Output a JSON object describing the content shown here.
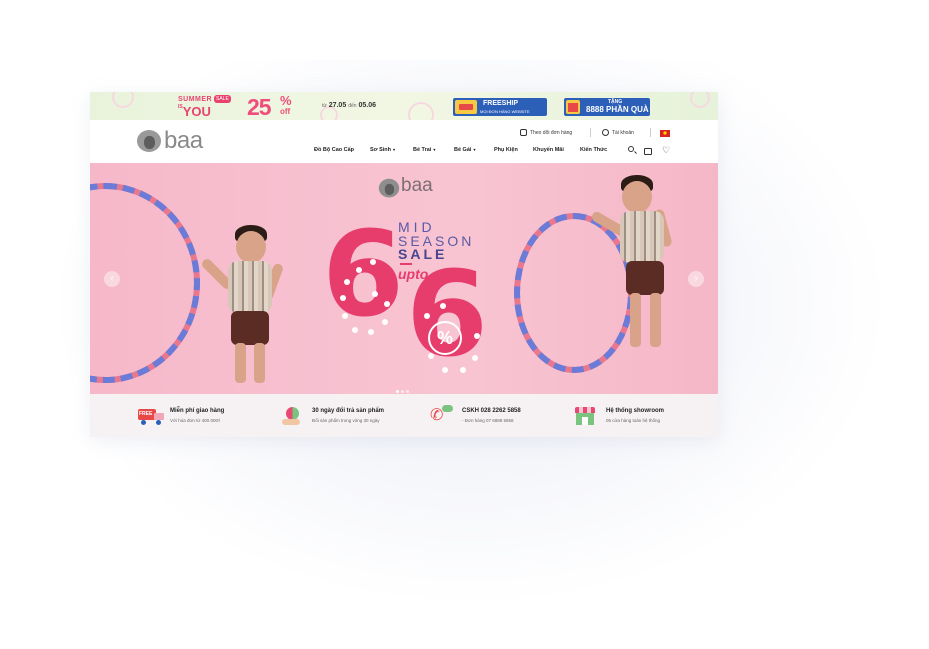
{
  "promo": {
    "summer_line1": "SUMMER",
    "summer_line2": "YOU",
    "summer_is": "IS",
    "summer_tag": "SALE",
    "discount_number": "25",
    "discount_pct": "%",
    "discount_off": "off",
    "date_from_label": "từ",
    "date_from": "27.05",
    "date_to_label": "đến",
    "date_to": "05.06",
    "freeship_title": "FREESHIP",
    "freeship_sub": "MỌI ĐƠN HÀNG WEBSITE",
    "gift_title": "TẶNG",
    "gift_sub": "8888 PHẦN QUÀ"
  },
  "header": {
    "logo_text": "baa",
    "order_tracking": "Theo dõi đơn hàng",
    "account": "Tài khoản",
    "nav": [
      {
        "label": "Đồ Bộ Cao Cấp",
        "caret": false
      },
      {
        "label": "Sơ Sinh",
        "caret": true
      },
      {
        "label": "Bé Trai",
        "caret": true
      },
      {
        "label": "Bé Gái",
        "caret": true
      },
      {
        "label": "Phụ Kiện",
        "caret": false
      },
      {
        "label": "Khuyến Mãi",
        "caret": false
      },
      {
        "label": "Kiến Thức",
        "caret": false
      }
    ],
    "caret_glyph": "▾"
  },
  "hero": {
    "logo_text": "baa",
    "line_mid": "MID",
    "line_season": "SEASON",
    "line_sale": "SALE",
    "upto": "upto",
    "digit_left": "6",
    "digit_right": "6",
    "percent": "%",
    "prev_glyph": "‹",
    "next_glyph": "›",
    "slide_count": 3,
    "active_slide": 1
  },
  "features": [
    {
      "icon": "free-truck-icon",
      "badge": "FREE",
      "title": "Miễn phí giao hàng",
      "sub": "Với hóa đơn từ 400.000₫"
    },
    {
      "icon": "exchange-icon",
      "title": "30 ngày đổi trả sản phẩm",
      "sub": "Đổi sản phẩm trong vòng 30 ngày"
    },
    {
      "icon": "phone-icon",
      "title": "CSKH 028 2262 5858",
      "sub": "- Đơn hàng 07 6888 5858"
    },
    {
      "icon": "store-icon",
      "title": "Hệ thống showroom",
      "sub": "05 cửa hàng toàn hệ thống"
    }
  ],
  "colors": {
    "brand_pink": "#e63d6c",
    "navy": "#5a5aa5",
    "promo_blue": "#2c5fb8",
    "hero_bg": "#f7bfcf"
  }
}
